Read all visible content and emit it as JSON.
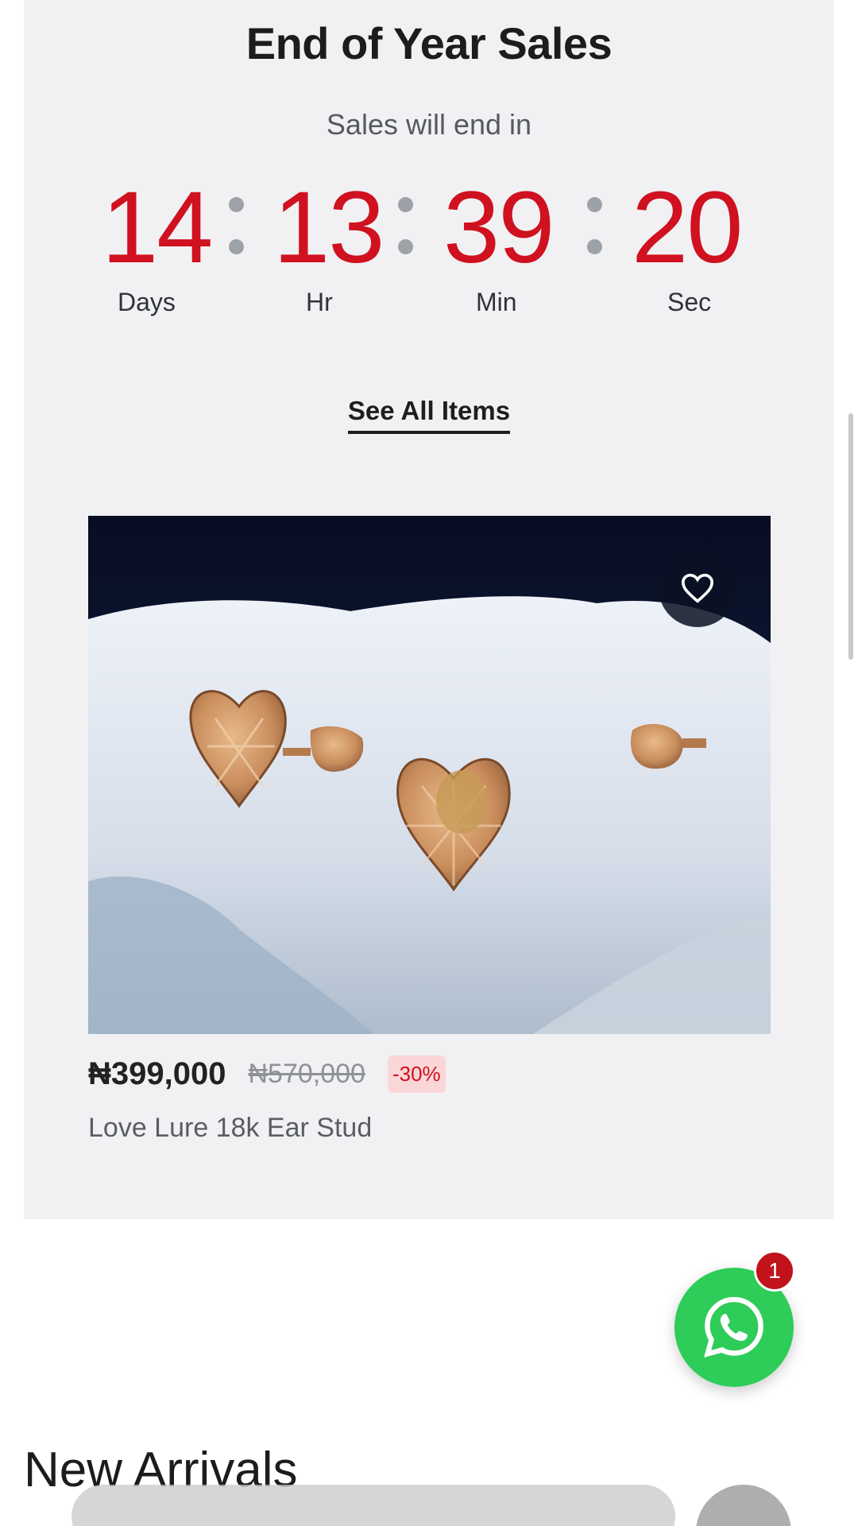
{
  "sale": {
    "title": "End of Year Sales",
    "subtitle": "Sales will end in",
    "countdown": [
      {
        "value": "14",
        "label": "Days"
      },
      {
        "value": "13",
        "label": "Hr"
      },
      {
        "value": "39",
        "label": "Min"
      },
      {
        "value": "20",
        "label": "Sec"
      }
    ],
    "see_all_label": "See All Items"
  },
  "product": {
    "price": "₦399,000",
    "old_price": "₦570,000",
    "discount": "-30%",
    "name": "Love Lure 18k Ear Stud"
  },
  "whatsapp": {
    "badge_count": "1"
  },
  "sections": {
    "new_arrivals": "New Arrivals"
  },
  "colors": {
    "countdown": "#d0111f",
    "discount_bg": "#fbd6d8",
    "whatsapp": "#2ecc58"
  }
}
